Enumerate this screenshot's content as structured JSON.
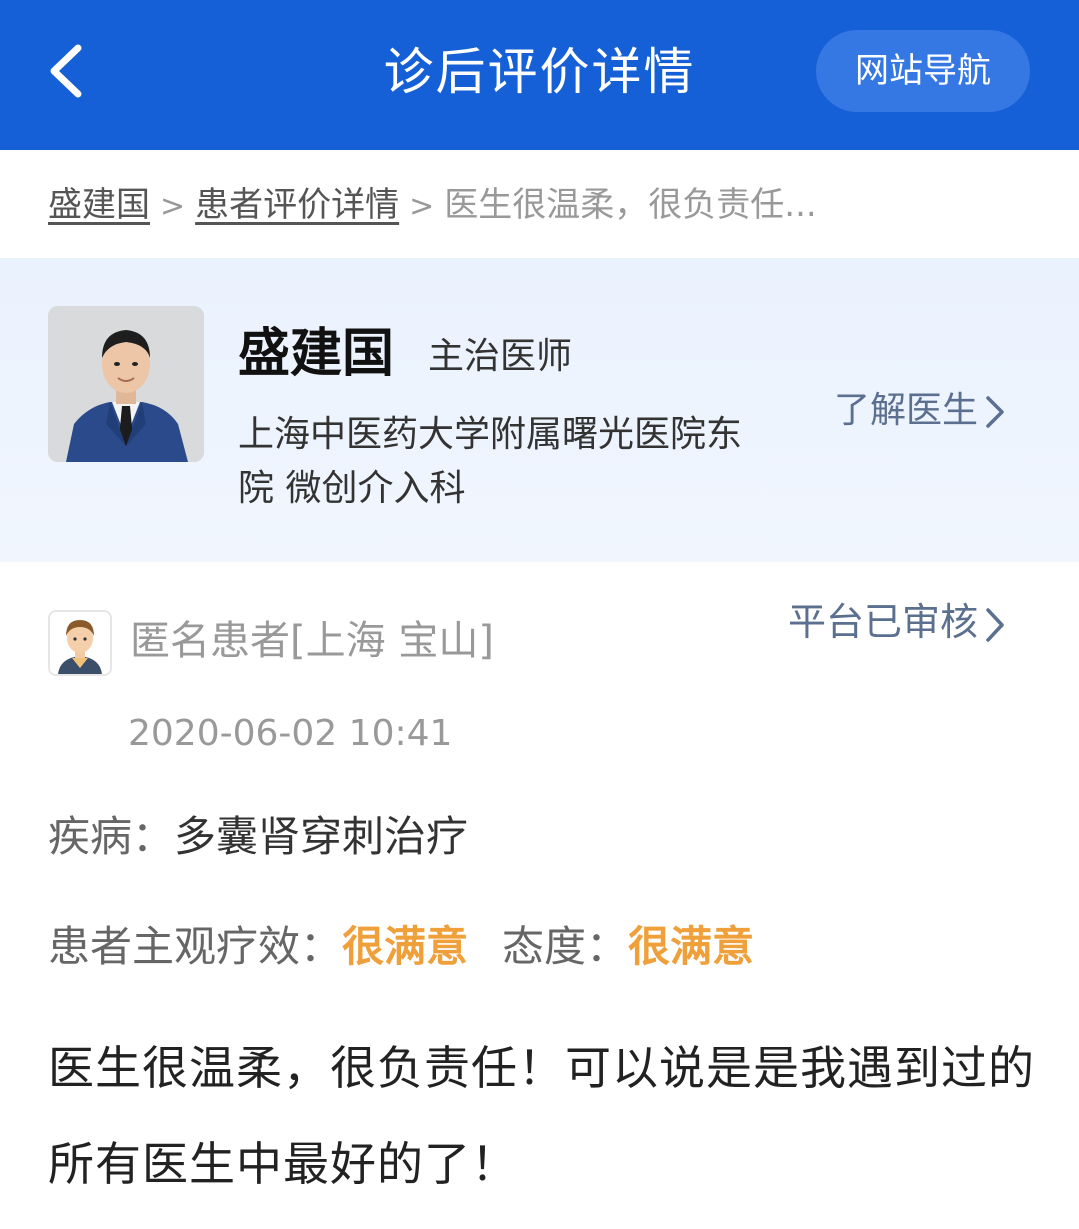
{
  "header": {
    "title": "诊后评价详情",
    "nav_button": "网站导航",
    "back_icon": "chevron-left-icon",
    "background": "#1560d6"
  },
  "breadcrumb": {
    "items": [
      "盛建国",
      "患者评价详情"
    ],
    "separator": ">",
    "current": "医生很温柔，很负责任..."
  },
  "doctor": {
    "name": "盛建国",
    "title": "主治医师",
    "hospital": "上海中医药大学附属曙光医院东院 微创介入科",
    "link_label": "了解医生"
  },
  "review": {
    "patient": "匿名患者[上海 宝山]",
    "verified_label": "平台已审核",
    "date": "2020-06-02 10:41",
    "disease_label": "疾病：",
    "disease": "多囊肾穿刺治疗",
    "effect_label": "患者主观疗效：",
    "effect_value": "很满意",
    "attitude_label": "态度：",
    "attitude_value": "很满意",
    "text": "医生很温柔，很负责任！可以说是是我遇到过的所有医生中最好的了！",
    "highlight_color": "#f0a03a"
  }
}
